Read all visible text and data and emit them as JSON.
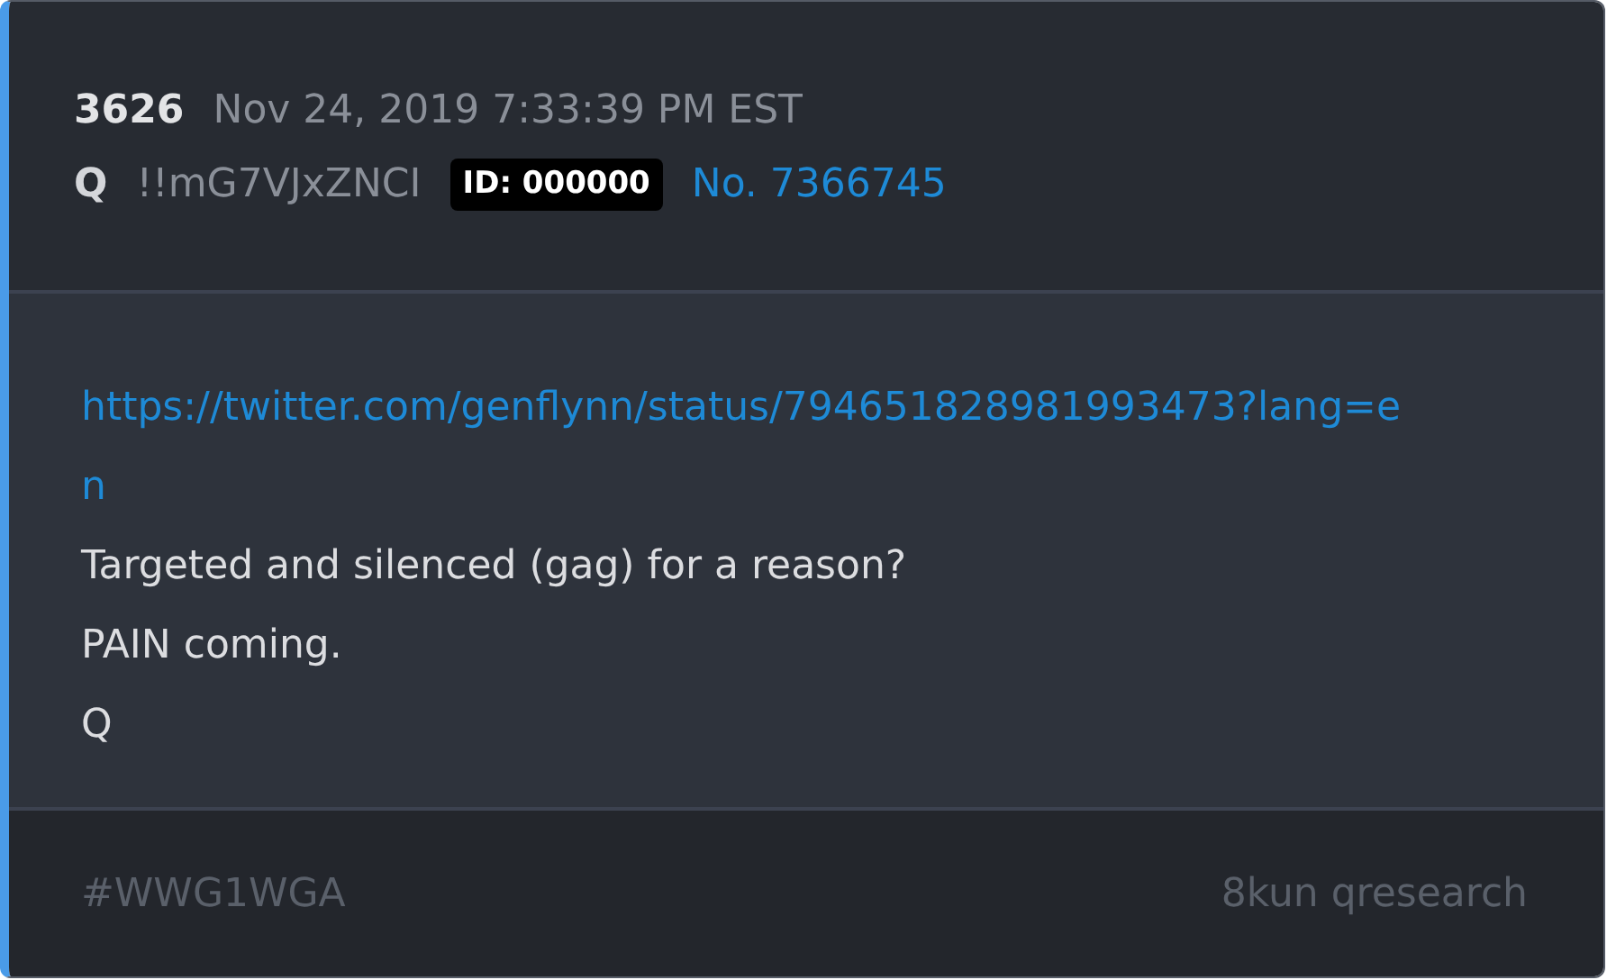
{
  "post": {
    "number": "3626",
    "timestamp": "Nov 24, 2019 7:33:39 PM EST",
    "author": "Q",
    "tripcode": "!!mG7VJxZNCI",
    "id_badge": "ID: 000000",
    "post_link": "No. 7366745",
    "body": [
      {
        "kind": "link",
        "text": "https://twitter.com/genflynn/status/794651828981993473?lang=en"
      },
      {
        "kind": "text",
        "text": "Targeted and silenced (gag) for a reason?"
      },
      {
        "kind": "text",
        "text": "PAIN coming."
      },
      {
        "kind": "text",
        "text": "Q"
      }
    ],
    "footer": {
      "hashtag": "#WWG1WGA",
      "source": "8kun qresearch"
    }
  }
}
